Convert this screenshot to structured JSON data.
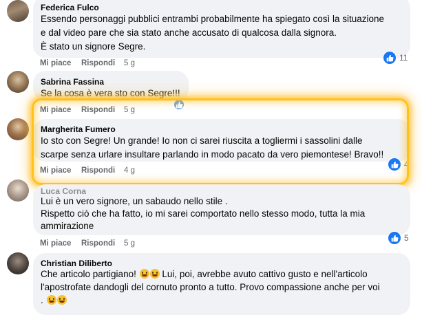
{
  "comments": [
    {
      "author": "Federica Fulco",
      "lines": [
        "Essendo personaggi pubblici entrambi probabilmente ha spiegato così la situazione",
        "e dal video pare che sia stato anche accusato di qualcosa dalla signora.",
        "È stato un signore Segre."
      ],
      "like_label": "Mi piace",
      "reply_label": "Rispondi",
      "time": "5 g",
      "reaction_count": "11"
    },
    {
      "author": "Sabrina Fassina",
      "lines": [
        "Se la cosa è vera sto con Segre!!!"
      ],
      "like_label": "Mi piace",
      "reply_label": "Rispondi",
      "time": "5 g"
    },
    {
      "author": "Margherita Fumero",
      "lines": [
        "Io sto con Segre! Un grande! Io non ci sarei riuscita a togliermi i sassolini dalle",
        "scarpe senza urlare insultare parlando in modo pacato da vero piemontese! Bravo!!"
      ],
      "like_label": "Mi piace",
      "reply_label": "Rispondi",
      "time": "4 g",
      "reaction_count": "4"
    },
    {
      "author": "Luca Corna",
      "lines": [
        "Lui è un vero signore, un sabaudo nello stile .",
        "Rispetto ciò che ha fatto, io mi sarei comportato nello stesso modo, tutta la mia",
        "ammirazione"
      ],
      "like_label": "Mi piace",
      "reply_label": "Rispondi",
      "time": "5 g",
      "reaction_count": "5"
    },
    {
      "author": "Christian Diliberto",
      "lines": [
        "Che articolo partigiano!",
        "Lui, poi, avrebbe avuto cattivo gusto e nell'articolo",
        "l'apostrofate dandogli del cornuto pronto a tutto. Provo compassione anche per voi",
        "."
      ]
    }
  ],
  "colors": {
    "bubble": "#f0f2f5",
    "like_blue": "#1877f2",
    "meta_grey": "#65676b",
    "highlight": "#ffc21a"
  }
}
